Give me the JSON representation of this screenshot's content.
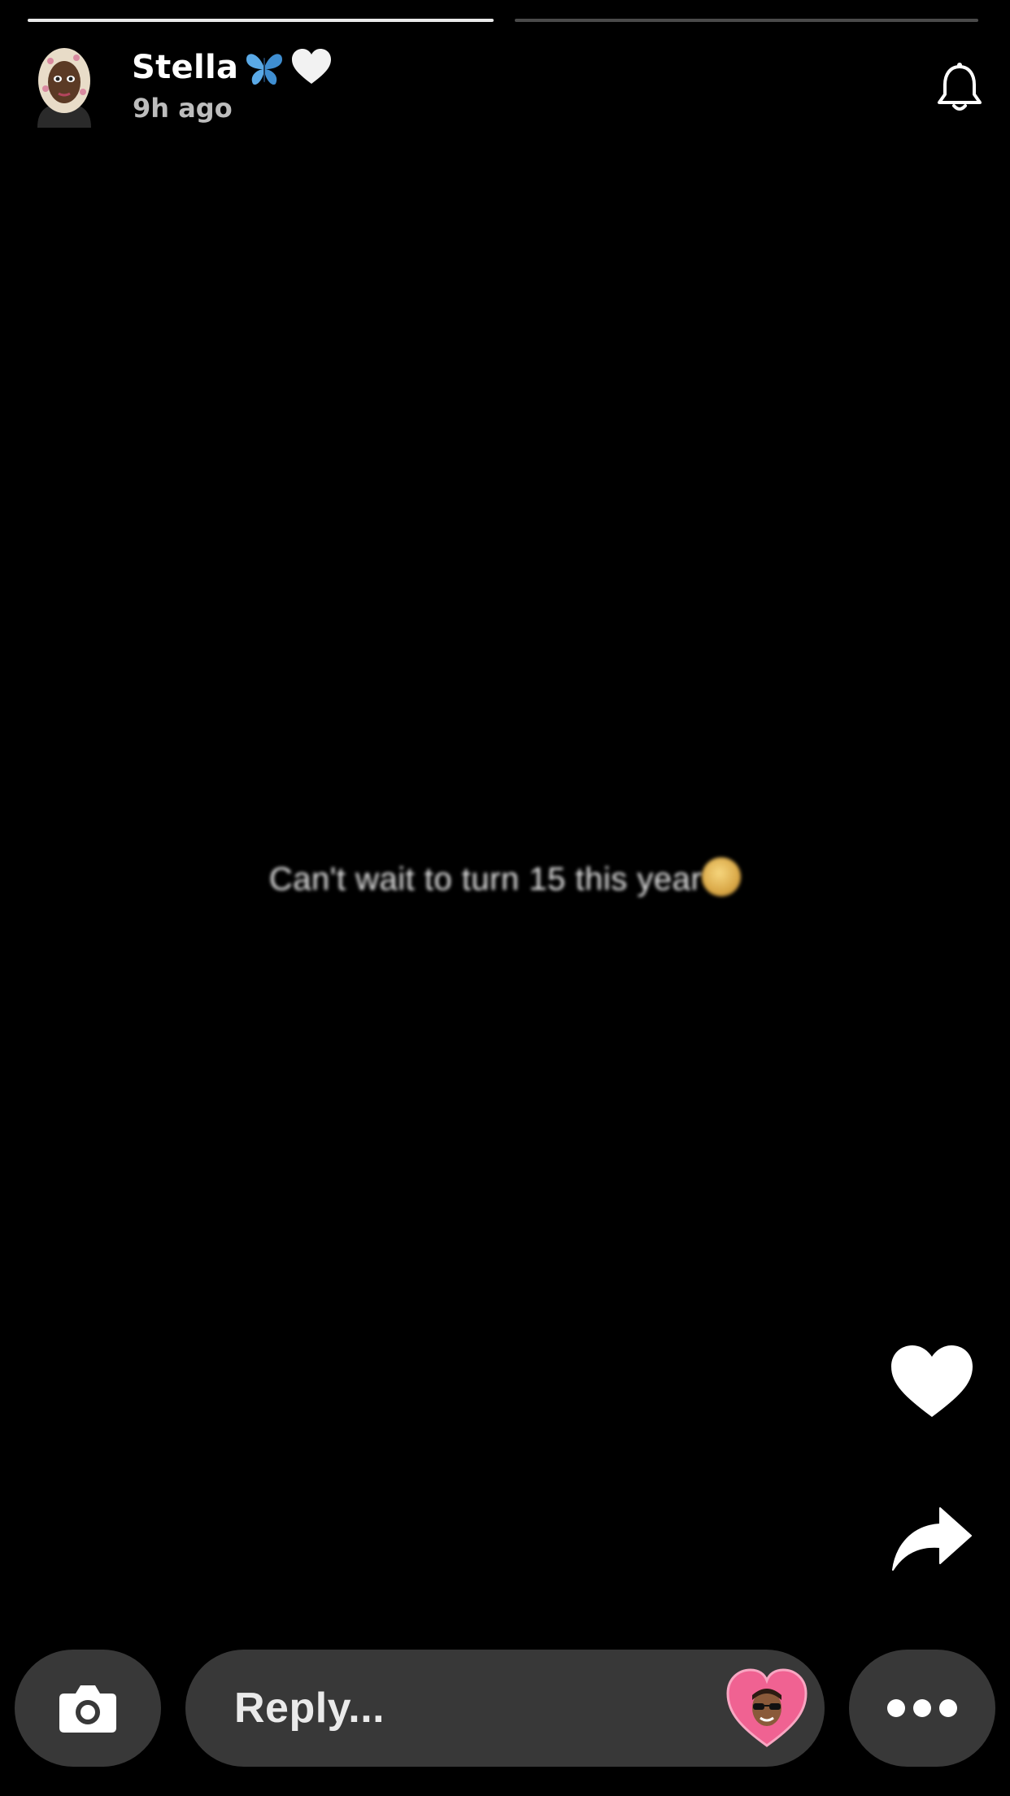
{
  "story": {
    "progress_segments": [
      {
        "state": "active"
      },
      {
        "state": "pending"
      }
    ],
    "user": {
      "name": "Stella",
      "name_emojis": [
        "butterfly-emoji",
        "white-heart-emoji"
      ],
      "posted_time": "9h ago",
      "avatar_icon": "bitmoji-avatar-icon"
    },
    "text": "Can't wait to turn 15 this year",
    "text_emoji": "smiling-face-emoji"
  },
  "actions": {
    "bell_icon": "bell-icon",
    "like_icon": "heart-icon",
    "share_icon": "share-arrow-icon"
  },
  "bottom_bar": {
    "camera_icon": "camera-icon",
    "reply_placeholder": "Reply...",
    "reply_heart_icon": "bitmoji-heart-icon",
    "more_icon": "more-dots-icon"
  },
  "colors": {
    "background": "#000000",
    "pill": "#383838",
    "progress_active": "#e9e9e9",
    "progress_pending": "#4a4a4a",
    "heart_pink": "#f06292",
    "butterfly_blue": "#5aa9e6"
  }
}
